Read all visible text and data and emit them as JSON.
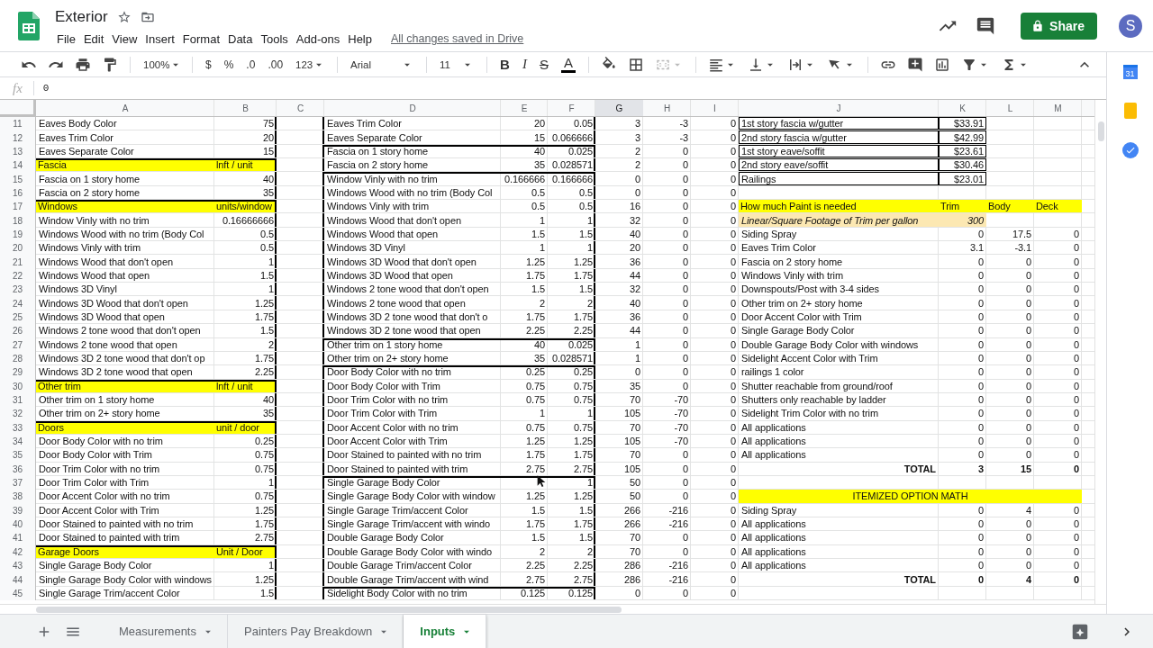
{
  "document": {
    "title": "Exterior",
    "save_status": "All changes saved in Drive"
  },
  "menu": [
    "File",
    "Edit",
    "View",
    "Insert",
    "Format",
    "Data",
    "Tools",
    "Add-ons",
    "Help"
  ],
  "share_button": "Share",
  "avatar": "S",
  "toolbar": {
    "zoom": "100%",
    "currency": "$",
    "percent": "%",
    "decrease_decimals": ".0",
    "increase_decimals": ".00",
    "more_formats": "123",
    "font": "Arial",
    "font_size": "11",
    "bold": "B",
    "italic": "I",
    "strikethrough": "S",
    "text_color": "A"
  },
  "formula_bar": {
    "fx": "fx",
    "value": "0"
  },
  "columns": [
    {
      "letter": "A",
      "selected": false
    },
    {
      "letter": "B",
      "selected": false
    },
    {
      "letter": "C",
      "selected": false
    },
    {
      "letter": "D",
      "selected": false
    },
    {
      "letter": "E",
      "selected": false
    },
    {
      "letter": "F",
      "selected": false
    },
    {
      "letter": "G",
      "selected": true
    },
    {
      "letter": "H",
      "selected": false
    },
    {
      "letter": "I",
      "selected": false
    },
    {
      "letter": "J",
      "selected": false
    },
    {
      "letter": "K",
      "selected": false
    },
    {
      "letter": "L",
      "selected": false
    },
    {
      "letter": "M",
      "selected": false
    }
  ],
  "rows": [
    {
      "number": "11",
      "rule_a": false,
      "rule_d": false,
      "cells": {
        "col_a": "Eaves Body Color",
        "col_b": "75",
        "col_d": "Eaves Trim Color",
        "col_e": "20",
        "col_f": "0.05",
        "col_g": "3",
        "col_h": "-3",
        "col_i": "0",
        "col_j": {
          "text": "1st story fascia w/gutter",
          "kind": "boxed"
        },
        "col_k": {
          "text": "$33.91",
          "kind": "boxed"
        }
      }
    },
    {
      "number": "12",
      "rule_a": false,
      "rule_d": false,
      "cells": {
        "col_a": "Eaves Trim Color",
        "col_b": "20",
        "col_d": "Eaves Separate Color",
        "col_e": "15",
        "col_f": "0.066666",
        "col_g": "3",
        "col_h": "-3",
        "col_i": "0",
        "col_j": {
          "text": "2nd story fascia w/gutter",
          "kind": "boxed"
        },
        "col_k": {
          "text": "$42.99",
          "kind": "boxed"
        }
      }
    },
    {
      "number": "13",
      "rule_a": false,
      "rule_d": true,
      "cells": {
        "col_a": "Eaves Separate Color",
        "col_b": "15",
        "col_d": "Fascia on 1 story home",
        "col_e": "40",
        "col_f": "0.025",
        "col_g": "2",
        "col_h": "0",
        "col_i": "0",
        "col_j": {
          "text": "1st story eave/soffit",
          "kind": "boxed"
        },
        "col_k": {
          "text": "$23.61",
          "kind": "boxed"
        }
      }
    },
    {
      "number": "14",
      "rule_a": true,
      "rule_d": false,
      "cells": {
        "col_a": {
          "text": "Fascia",
          "kind": "header"
        },
        "col_b": {
          "text": "lnft / unit",
          "kind": "header"
        },
        "col_d": "Fascia on 2 story home",
        "col_e": "35",
        "col_f": "0.028571",
        "col_g": "2",
        "col_h": "0",
        "col_i": "0",
        "col_j": {
          "text": "2nd story eave/soffit",
          "kind": "boxed"
        },
        "col_k": {
          "text": "$30.46",
          "kind": "boxed"
        }
      }
    },
    {
      "number": "15",
      "rule_a": false,
      "rule_d": true,
      "cells": {
        "col_a": "Fascia on 1 story home",
        "col_b": "40",
        "col_d": "Window Vinly with no trim",
        "col_e": "0.166666",
        "col_f": "0.166666",
        "col_g": "0",
        "col_h": "0",
        "col_i": "0",
        "col_j": {
          "text": "Railings",
          "kind": "boxed"
        },
        "col_k": {
          "text": "$23.01",
          "kind": "boxed"
        }
      }
    },
    {
      "number": "16",
      "rule_a": false,
      "rule_d": false,
      "cells": {
        "col_a": "Fascia on 2 story home",
        "col_b": "35",
        "col_d": "Windows Wood with no trim (Body Col",
        "col_e": "0.5",
        "col_f": "0.5",
        "col_g": "0",
        "col_h": "0",
        "col_i": "0"
      }
    },
    {
      "number": "17",
      "rule_a": true,
      "rule_d": false,
      "cells": {
        "col_a": {
          "text": "Windows",
          "kind": "header"
        },
        "col_b": {
          "text": "units/window",
          "kind": "header"
        },
        "col_d": "Windows Vinly with trim",
        "col_e": "0.5",
        "col_f": "0.5",
        "col_g": "16",
        "col_h": "0",
        "col_i": "0",
        "col_j": {
          "text": "How much Paint is needed",
          "kind": "header"
        },
        "col_k": {
          "text": "Trim",
          "kind": "header"
        },
        "col_l": {
          "text": "Body",
          "kind": "header"
        },
        "col_m": {
          "text": "Deck",
          "kind": "header"
        }
      }
    },
    {
      "number": "18",
      "rule_a": false,
      "rule_d": false,
      "cells": {
        "col_a": "Window Vinly with no trim",
        "col_b": "0.16666666",
        "col_d": "Windows Wood that don't open",
        "col_e": "1",
        "col_f": "1",
        "col_g": "32",
        "col_h": "0",
        "col_i": "0",
        "col_j": {
          "text": "Linear/Square Footage of Trim per gallon",
          "kind": "input"
        },
        "col_k": {
          "text": "300",
          "kind": "input"
        }
      }
    },
    {
      "number": "19",
      "rule_a": false,
      "rule_d": false,
      "cells": {
        "col_a": "Windows Wood with no trim (Body Col",
        "col_b": "0.5",
        "col_d": "Windows Wood that open",
        "col_e": "1.5",
        "col_f": "1.5",
        "col_g": "40",
        "col_h": "0",
        "col_i": "0",
        "col_j": "Siding Spray",
        "col_k": "0",
        "col_l": "17.5",
        "col_m": "0"
      }
    },
    {
      "number": "20",
      "rule_a": false,
      "rule_d": false,
      "cells": {
        "col_a": "Windows Vinly with trim",
        "col_b": "0.5",
        "col_d": "Windows 3D Vinyl",
        "col_e": "1",
        "col_f": "1",
        "col_g": "20",
        "col_h": "0",
        "col_i": "0",
        "col_j": "Eaves Trim Color",
        "col_k": "3.1",
        "col_l": "-3.1",
        "col_m": "0"
      }
    },
    {
      "number": "21",
      "rule_a": false,
      "rule_d": false,
      "cells": {
        "col_a": "Windows Wood that don't open",
        "col_b": "1",
        "col_d": "Windows 3D Wood that don't open",
        "col_e": "1.25",
        "col_f": "1.25",
        "col_g": "36",
        "col_h": "0",
        "col_i": "0",
        "col_j": "Fascia on 2 story home",
        "col_k": "0",
        "col_l": "0",
        "col_m": "0"
      }
    },
    {
      "number": "22",
      "rule_a": false,
      "rule_d": false,
      "cells": {
        "col_a": "Windows Wood that open",
        "col_b": "1.5",
        "col_d": "Windows 3D Wood that open",
        "col_e": "1.75",
        "col_f": "1.75",
        "col_g": "44",
        "col_h": "0",
        "col_i": "0",
        "col_j": "Windows Vinly with trim",
        "col_k": "0",
        "col_l": "0",
        "col_m": "0"
      }
    },
    {
      "number": "23",
      "rule_a": false,
      "rule_d": false,
      "cells": {
        "col_a": "Windows 3D Vinyl",
        "col_b": "1",
        "col_d": "Windows 2 tone wood that don't open",
        "col_e": "1.5",
        "col_f": "1.5",
        "col_g": "32",
        "col_h": "0",
        "col_i": "0",
        "col_j": "Downspouts/Post with 3-4 sides",
        "col_k": "0",
        "col_l": "0",
        "col_m": "0"
      }
    },
    {
      "number": "24",
      "rule_a": false,
      "rule_d": false,
      "cells": {
        "col_a": "Windows 3D Wood that don't open",
        "col_b": "1.25",
        "col_d": "Windows 2 tone wood that open",
        "col_e": "2",
        "col_f": "2",
        "col_g": "40",
        "col_h": "0",
        "col_i": "0",
        "col_j": "Other trim on 2+ story home",
        "col_k": "0",
        "col_l": "0",
        "col_m": "0"
      }
    },
    {
      "number": "25",
      "rule_a": false,
      "rule_d": false,
      "cells": {
        "col_a": "Windows 3D Wood that open",
        "col_b": "1.75",
        "col_d": "Windows 3D 2 tone wood that don't o",
        "col_e": "1.75",
        "col_f": "1.75",
        "col_g": "36",
        "col_h": "0",
        "col_i": "0",
        "col_j": "Door Accent Color with Trim",
        "col_k": "0",
        "col_l": "0",
        "col_m": "0"
      }
    },
    {
      "number": "26",
      "rule_a": false,
      "rule_d": false,
      "cells": {
        "col_a": "Windows 2 tone wood that don't open",
        "col_b": "1.5",
        "col_d": "Windows 3D 2 tone wood that open",
        "col_e": "2.25",
        "col_f": "2.25",
        "col_g": "44",
        "col_h": "0",
        "col_i": "0",
        "col_j": "Single Garage Body Color",
        "col_k": "0",
        "col_l": "0",
        "col_m": "0"
      }
    },
    {
      "number": "27",
      "rule_a": false,
      "rule_d": true,
      "cells": {
        "col_a": "Windows 2 tone wood that open",
        "col_b": "2",
        "col_d": "Other trim on 1 story home",
        "col_e": "40",
        "col_f": "0.025",
        "col_g": "1",
        "col_h": "0",
        "col_i": "0",
        "col_j": "Double Garage Body Color with windows",
        "col_k": "0",
        "col_l": "0",
        "col_m": "0"
      }
    },
    {
      "number": "28",
      "rule_a": false,
      "rule_d": false,
      "cells": {
        "col_a": "Windows 3D 2 tone wood that don't op",
        "col_b": "1.75",
        "col_d": "Other trim on 2+ story home",
        "col_e": "35",
        "col_f": "0.028571",
        "col_g": "1",
        "col_h": "0",
        "col_i": "0",
        "col_j": "Sidelight Accent Color with Trim",
        "col_k": "0",
        "col_l": "0",
        "col_m": "0"
      }
    },
    {
      "number": "29",
      "rule_a": false,
      "rule_d": true,
      "cells": {
        "col_a": "Windows 3D 2 tone wood that open",
        "col_b": "2.25",
        "col_d": "Door Body Color with no trim",
        "col_e": "0.25",
        "col_f": "0.25",
        "col_g": "0",
        "col_h": "0",
        "col_i": "0",
        "col_j": "railings 1 color",
        "col_k": "0",
        "col_l": "0",
        "col_m": "0"
      }
    },
    {
      "number": "30",
      "rule_a": true,
      "rule_d": false,
      "cells": {
        "col_a": {
          "text": "Other trim",
          "kind": "header"
        },
        "col_b": {
          "text": "lnft / unit",
          "kind": "header"
        },
        "col_d": "Door Body Color with Trim",
        "col_e": "0.75",
        "col_f": "0.75",
        "col_g": "35",
        "col_h": "0",
        "col_i": "0",
        "col_j": "Shutter reachable from ground/roof",
        "col_k": "0",
        "col_l": "0",
        "col_m": "0"
      }
    },
    {
      "number": "31",
      "rule_a": false,
      "rule_d": false,
      "cells": {
        "col_a": "Other trim on 1 story home",
        "col_b": "40",
        "col_d": "Door Trim Color with no trim",
        "col_e": "0.75",
        "col_f": "0.75",
        "col_g": "70",
        "col_h": "-70",
        "col_i": "0",
        "col_j": "Shutters only reachable by ladder",
        "col_k": "0",
        "col_l": "0",
        "col_m": "0"
      }
    },
    {
      "number": "32",
      "rule_a": false,
      "rule_d": false,
      "cells": {
        "col_a": "Other trim on 2+ story home",
        "col_b": "35",
        "col_d": "Door Trim Color with Trim",
        "col_e": "1",
        "col_f": "1",
        "col_g": "105",
        "col_h": "-70",
        "col_i": "0",
        "col_j": "Sidelight Trim Color with no trim",
        "col_k": "0",
        "col_l": "0",
        "col_m": "0"
      }
    },
    {
      "number": "33",
      "rule_a": true,
      "rule_d": false,
      "cells": {
        "col_a": {
          "text": "Doors",
          "kind": "header"
        },
        "col_b": {
          "text": "unit / door",
          "kind": "header"
        },
        "col_d": "Door Accent Color with no trim",
        "col_e": "0.75",
        "col_f": "0.75",
        "col_g": "70",
        "col_h": "-70",
        "col_i": "0",
        "col_j": "All applications",
        "col_k": "0",
        "col_l": "0",
        "col_m": "0"
      }
    },
    {
      "number": "34",
      "rule_a": false,
      "rule_d": false,
      "cells": {
        "col_a": "Door Body Color with no trim",
        "col_b": "0.25",
        "col_d": "Door Accent Color with Trim",
        "col_e": "1.25",
        "col_f": "1.25",
        "col_g": "105",
        "col_h": "-70",
        "col_i": "0",
        "col_j": "All applications",
        "col_k": "0",
        "col_l": "0",
        "col_m": "0"
      }
    },
    {
      "number": "35",
      "rule_a": false,
      "rule_d": false,
      "cells": {
        "col_a": "Door Body Color with Trim",
        "col_b": "0.75",
        "col_d": "Door Stained to painted with no trim",
        "col_e": "1.75",
        "col_f": "1.75",
        "col_g": "70",
        "col_h": "0",
        "col_i": "0",
        "col_j": "All applications",
        "col_k": "0",
        "col_l": "0",
        "col_m": "0"
      }
    },
    {
      "number": "36",
      "rule_a": false,
      "rule_d": false,
      "cells": {
        "col_a": "Door Trim Color with no trim",
        "col_b": "0.75",
        "col_d": "Door Stained to painted with trim",
        "col_e": "2.75",
        "col_f": "2.75",
        "col_g": "105",
        "col_h": "0",
        "col_i": "0",
        "col_j": {
          "text": "TOTAL",
          "kind": "total"
        },
        "col_k": {
          "text": "3",
          "kind": "total"
        },
        "col_l": {
          "text": "15",
          "kind": "total"
        },
        "col_m": {
          "text": "0",
          "kind": "total"
        }
      }
    },
    {
      "number": "37",
      "rule_a": false,
      "rule_d": true,
      "cells": {
        "col_a": "Door Trim Color with Trim",
        "col_b": "1",
        "col_d": "Single Garage Body Color",
        "col_f": "1",
        "col_g": "50",
        "col_h": "0",
        "col_i": "0"
      }
    },
    {
      "number": "38",
      "rule_a": false,
      "rule_d": false,
      "cells": {
        "col_a": "Door Accent Color with no trim",
        "col_b": "0.75",
        "col_d": "Single Garage Body Color with window",
        "col_e": "1.25",
        "col_f": "1.25",
        "col_g": "50",
        "col_h": "0",
        "col_i": "0",
        "col_j": {
          "text": "ITEMIZED OPTION MATH",
          "kind": "banner"
        }
      }
    },
    {
      "number": "39",
      "rule_a": false,
      "rule_d": false,
      "cells": {
        "col_a": "Door Accent Color with Trim",
        "col_b": "1.25",
        "col_d": "Single Garage Trim/accent Color",
        "col_e": "1.5",
        "col_f": "1.5",
        "col_g": "266",
        "col_h": "-216",
        "col_i": "0",
        "col_j": "Siding Spray",
        "col_k": "0",
        "col_l": "4",
        "col_m": "0"
      }
    },
    {
      "number": "40",
      "rule_a": false,
      "rule_d": false,
      "cells": {
        "col_a": "Door Stained to painted with no trim",
        "col_b": "1.75",
        "col_d": "Single Garage Trim/accent  with windo",
        "col_e": "1.75",
        "col_f": "1.75",
        "col_g": "266",
        "col_h": "-216",
        "col_i": "0",
        "col_j": "All applications",
        "col_k": "0",
        "col_l": "0",
        "col_m": "0"
      }
    },
    {
      "number": "41",
      "rule_a": false,
      "rule_d": false,
      "cells": {
        "col_a": "Door Stained to painted with trim",
        "col_b": "2.75",
        "col_d": "Double Garage Body Color",
        "col_e": "1.5",
        "col_f": "1.5",
        "col_g": "70",
        "col_h": "0",
        "col_i": "0",
        "col_j": "All applications",
        "col_k": "0",
        "col_l": "0",
        "col_m": "0"
      }
    },
    {
      "number": "42",
      "rule_a": true,
      "rule_d": false,
      "cells": {
        "col_a": {
          "text": "Garage Doors",
          "kind": "header"
        },
        "col_b": {
          "text": "Unit / Door",
          "kind": "header"
        },
        "col_d": "Double Garage Body Color with windo",
        "col_e": "2",
        "col_f": "2",
        "col_g": "70",
        "col_h": "0",
        "col_i": "0",
        "col_j": "All applications",
        "col_k": "0",
        "col_l": "0",
        "col_m": "0"
      }
    },
    {
      "number": "43",
      "rule_a": false,
      "rule_d": false,
      "cells": {
        "col_a": "Single Garage Body Color",
        "col_b": "1",
        "col_d": "Double Garage Trim/accent Color",
        "col_e": "2.25",
        "col_f": "2.25",
        "col_g": "286",
        "col_h": "-216",
        "col_i": "0",
        "col_j": "All applications",
        "col_k": "0",
        "col_l": "0",
        "col_m": "0"
      }
    },
    {
      "number": "44",
      "rule_a": false,
      "rule_d": false,
      "cells": {
        "col_a": "Single Garage Body Color with windows",
        "col_b": "1.25",
        "col_d": "Double Garage Trim/accent  with wind",
        "col_e": "2.75",
        "col_f": "2.75",
        "col_g": "286",
        "col_h": "-216",
        "col_i": "0",
        "col_j": {
          "text": "TOTAL",
          "kind": "total"
        },
        "col_k": {
          "text": "0",
          "kind": "total"
        },
        "col_l": {
          "text": "4",
          "kind": "total"
        },
        "col_m": {
          "text": "0",
          "kind": "total"
        }
      }
    },
    {
      "number": "45",
      "rule_a": false,
      "rule_d": true,
      "cells": {
        "col_a": "Single Garage Trim/accent Color",
        "col_b": "1.5",
        "col_d": "Sidelight Body Color with no trim",
        "col_e": "0.125",
        "col_f": "0.125",
        "col_g": "0",
        "col_h": "0",
        "col_i": "0"
      }
    }
  ],
  "sheet_tabs": [
    {
      "label": "Measurements",
      "selected": false
    },
    {
      "label": "Painters Pay Breakdown",
      "selected": false
    },
    {
      "label": "Inputs",
      "selected": true
    }
  ],
  "side_panel": {
    "calendar_label": "31"
  }
}
